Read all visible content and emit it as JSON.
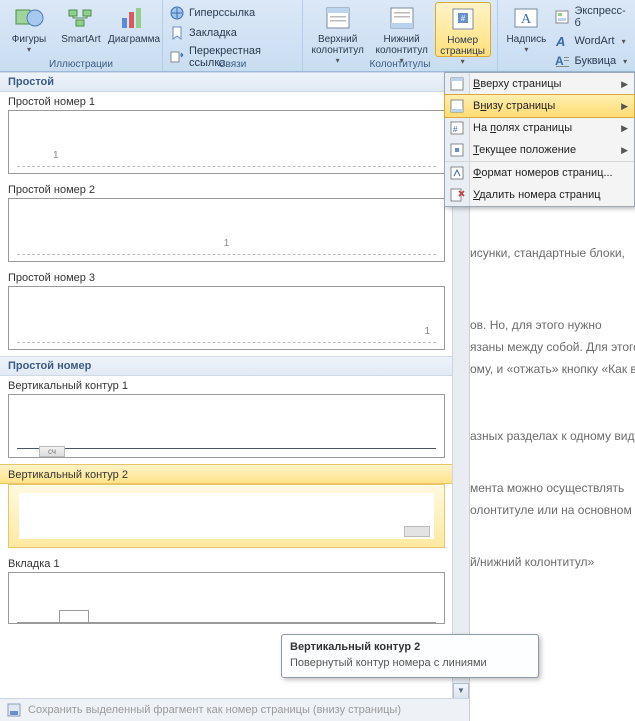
{
  "ribbon": {
    "groups": {
      "illustrations": {
        "caption": "Иллюстрации",
        "shapes": "Фигуры",
        "smartart": "SmartArt",
        "chart": "Диаграмма"
      },
      "links": {
        "caption": "Связи",
        "hyperlink": "Гиперссылка",
        "bookmark": "Закладка",
        "crossref": "Перекрестная ссылка"
      },
      "headerfooter": {
        "caption": "Колонтитулы",
        "header": "Верхний колонтитул",
        "footer": "Нижний колонтитул",
        "pageno": "Номер страницы"
      },
      "text": {
        "textbox": "Надпись",
        "quickparts": "Экспресс-б",
        "wordart": "WordArt",
        "dropcap": "Буквица"
      }
    }
  },
  "menu": {
    "top": "Вверху страницы",
    "bottom": "Внизу страницы",
    "margins": "На полях страницы",
    "current": "Текущее положение",
    "format": "Формат номеров страниц...",
    "remove": "Удалить номера страниц"
  },
  "gallery": {
    "section_simple": "Простой",
    "items_simple": [
      {
        "label": "Простой номер 1"
      },
      {
        "label": "Простой номер 2"
      },
      {
        "label": "Простой номер 3"
      }
    ],
    "section_simpleno": "Простой номер",
    "items_vk": [
      {
        "label": "Вертикальный контур 1"
      },
      {
        "label": "Вертикальный контур 2"
      },
      {
        "label": "Вкладка 1"
      }
    ],
    "footer": "Сохранить выделенный фрагмент как номер страницы (внизу страницы)"
  },
  "tooltip": {
    "title": "Вертикальный контур 2",
    "desc": "Повернутый контур номера с линиями"
  },
  "doc": {
    "l1": "исунки, стандартные блоки,",
    "l2": "ов. Но, для этого нужно",
    "l3": "язаны между собой. Для этого",
    "l4": "ому, и «отжать» кнопку «Как в",
    "l5": "азных разделах к одному виду,",
    "l6": "мента можно осуществлять",
    "l7": "олонтитуле или на основном",
    "l8": "й/нижний колонтитул»"
  }
}
